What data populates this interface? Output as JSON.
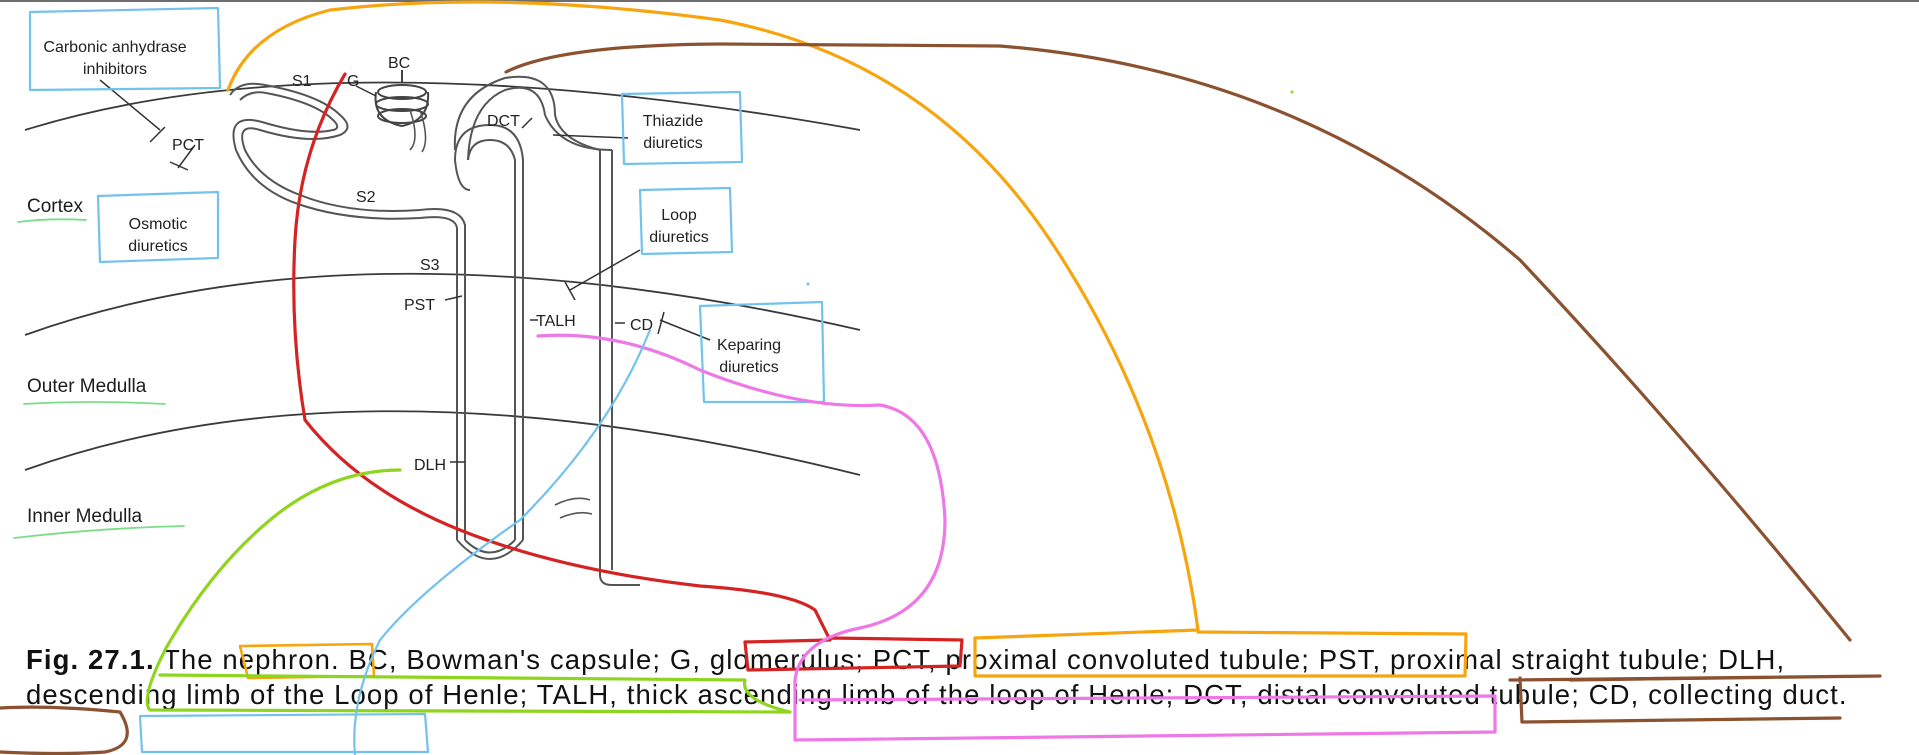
{
  "zones": {
    "cortex": "Cortex",
    "outer_medulla": "Outer Medulla",
    "inner_medulla": "Inner Medulla"
  },
  "segments": {
    "s1": "S1",
    "g": "G",
    "bc": "BC",
    "pct": "PCT",
    "dct": "DCT",
    "s2": "S2",
    "s3": "S3",
    "pst": "PST",
    "talh": "TALH",
    "cd": "CD",
    "dlh": "DLH"
  },
  "drug_boxes": {
    "carbonic": [
      "Carbonic anhydrase",
      "inhibitors"
    ],
    "osmotic": [
      "Osmotic",
      "diuretics"
    ],
    "thiazide": [
      "Thiazide",
      "diuretics"
    ],
    "loop": [
      "Loop",
      "diuretics"
    ],
    "ksparing": [
      "Keparing",
      "diuretics"
    ]
  },
  "caption": {
    "fig": "Fig. 27.1.",
    "text": "The nephron. BC, Bowman's capsule; G, glomerulus; PCT, proximal convoluted tubule; PST, proximal straight tubule; DLH, descending limb of the Loop of Henle; TALH, thick ascending limb of the loop of Henle; DCT, distal convoluted tubule; CD, collecting duct."
  },
  "colors": {
    "red": "#d42323",
    "orange": "#f6a50f",
    "brown": "#8a5230",
    "pink": "#ee78e6",
    "green": "#8fd41f",
    "blue": "#72c2ec",
    "zone_underline": "#7ddc8a"
  }
}
